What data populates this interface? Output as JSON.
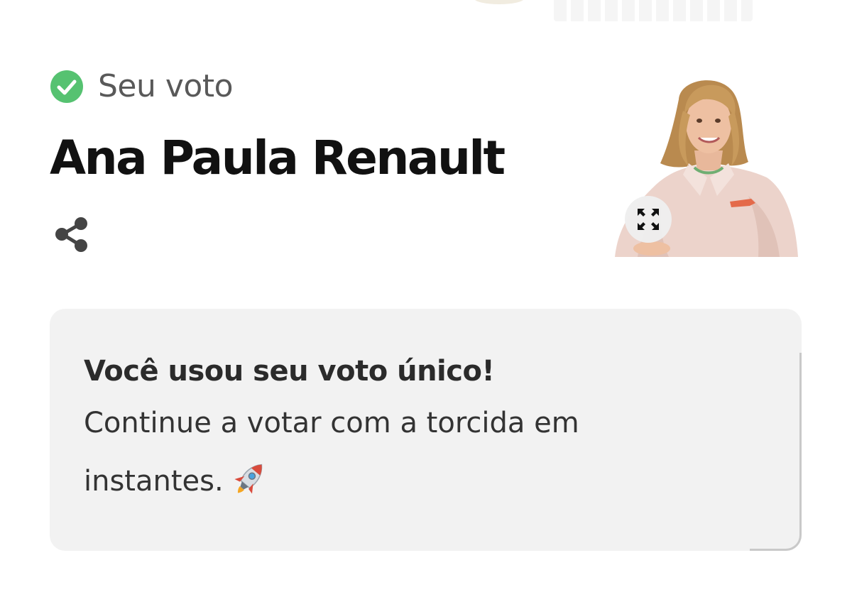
{
  "vote_status": {
    "label": "Seu voto",
    "icon": "check-circle-icon",
    "icon_color": "#56c271"
  },
  "candidate": {
    "name": "Ana Paula Renault",
    "photo": "candidate-photo",
    "expand_icon": "expand-icon"
  },
  "share": {
    "icon": "share-icon",
    "color": "#444444"
  },
  "message": {
    "title": "Você usou seu voto único!",
    "body": "Continue a votar com a torcida em instantes.",
    "emoji_icon": "rocket-icon",
    "background": "#f2f2f2"
  },
  "colors": {
    "page_background": "#ffffff",
    "name_text": "#111111",
    "label_text": "#595959"
  }
}
